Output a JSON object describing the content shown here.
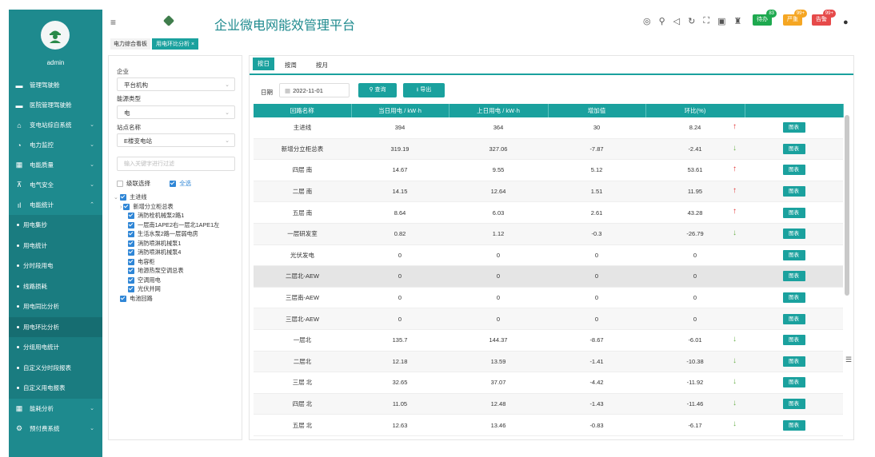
{
  "app": {
    "title": "企业微电网能效管理平台",
    "user": "admin"
  },
  "colors": {
    "sidebar": "#1e8a8e",
    "accent": "#1aa19e",
    "up": "#e03030",
    "down": "#6ab04c"
  },
  "sidebar": {
    "items": [
      {
        "label": "管理驾驶舱",
        "icon": "monitor-icon"
      },
      {
        "label": "医院管理驾驶舱",
        "icon": "monitor-icon"
      },
      {
        "label": "变电站综自系统",
        "icon": "home-icon"
      },
      {
        "label": "电力监控",
        "icon": "gauge-icon"
      },
      {
        "label": "电能质量",
        "icon": "chart-icon"
      },
      {
        "label": "电气安全",
        "icon": "tower-icon"
      },
      {
        "label": "电能统计",
        "icon": "bars-icon"
      }
    ],
    "sub_items": [
      "用电集抄",
      "用电统计",
      "分时段用电",
      "线路损耗",
      "用电同比分析",
      "用电环比分析",
      "分组用电统计",
      "自定义分时段报表",
      "自定义用电报表"
    ],
    "bottom_items": [
      {
        "label": "能耗分析",
        "icon": "chart-icon"
      },
      {
        "label": "预付费系统",
        "icon": "gear-icon"
      }
    ]
  },
  "tabs": {
    "home": "电力综合看板",
    "current": "用电环比分析 ×"
  },
  "badges": {
    "b1": "待办",
    "b1n": "83",
    "b2": "严重",
    "b2n": "99+",
    "b3": "告警",
    "b3n": "99+"
  },
  "filters": {
    "company_label": "企业",
    "company_value": "平台机构",
    "energy_label": "能源类型",
    "energy_value": "电",
    "station_label": "站点名称",
    "station_value": "E楼变电站",
    "search_placeholder": "输入关键字进行过滤",
    "cascade_label": "级联选择",
    "all_label": "全选"
  },
  "tree": {
    "root": "主进线",
    "child": "新增分立柜总表",
    "leaves": [
      "消防栓机械泵2路1",
      "一层南1APE2右一层北1APE1左",
      "生活水泵2路一层弱电房",
      "消防喷淋机械泵1",
      "消防喷淋机械泵4",
      "电容柜",
      "地源热泵空调总表",
      "空调用电",
      "光伏并网"
    ],
    "last": "电池回路"
  },
  "panel": {
    "tabs": [
      "按日",
      "按周",
      "按月"
    ],
    "date_label": "日期",
    "date_value": "2022-11-01",
    "query_label": "查询",
    "export_label": "导出",
    "columns": [
      "回路名称",
      "当日用电 / kW·h",
      "上日用电 / kW·h",
      "增加值",
      "环比(%)",
      ""
    ],
    "chart_button": "图表",
    "rows": [
      {
        "name": "主进线",
        "today": "394",
        "yesterday": "364",
        "diff": "30",
        "ratio": "8.24",
        "trend": "up"
      },
      {
        "name": "新增分立柜总表",
        "today": "319.19",
        "yesterday": "327.06",
        "diff": "-7.87",
        "ratio": "-2.41",
        "trend": "down"
      },
      {
        "name": "四层 南",
        "today": "14.67",
        "yesterday": "9.55",
        "diff": "5.12",
        "ratio": "53.61",
        "trend": "up"
      },
      {
        "name": "二层 南",
        "today": "14.15",
        "yesterday": "12.64",
        "diff": "1.51",
        "ratio": "11.95",
        "trend": "up"
      },
      {
        "name": "五层 南",
        "today": "8.64",
        "yesterday": "6.03",
        "diff": "2.61",
        "ratio": "43.28",
        "trend": "up"
      },
      {
        "name": "一层研发室",
        "today": "0.82",
        "yesterday": "1.12",
        "diff": "-0.3",
        "ratio": "-26.79",
        "trend": "down"
      },
      {
        "name": "光伏发电",
        "today": "0",
        "yesterday": "0",
        "diff": "0",
        "ratio": "0",
        "trend": ""
      },
      {
        "name": "二层北-AEW",
        "today": "0",
        "yesterday": "0",
        "diff": "0",
        "ratio": "0",
        "trend": ""
      },
      {
        "name": "三层南-AEW",
        "today": "0",
        "yesterday": "0",
        "diff": "0",
        "ratio": "0",
        "trend": ""
      },
      {
        "name": "三层北-AEW",
        "today": "0",
        "yesterday": "0",
        "diff": "0",
        "ratio": "0",
        "trend": ""
      },
      {
        "name": "一层北",
        "today": "135.7",
        "yesterday": "144.37",
        "diff": "-8.67",
        "ratio": "-6.01",
        "trend": "down"
      },
      {
        "name": "二层北",
        "today": "12.18",
        "yesterday": "13.59",
        "diff": "-1.41",
        "ratio": "-10.38",
        "trend": "down"
      },
      {
        "name": "三层 北",
        "today": "32.65",
        "yesterday": "37.07",
        "diff": "-4.42",
        "ratio": "-11.92",
        "trend": "down"
      },
      {
        "name": "四层 北",
        "today": "11.05",
        "yesterday": "12.48",
        "diff": "-1.43",
        "ratio": "-11.46",
        "trend": "down"
      },
      {
        "name": "五层 北",
        "today": "12.63",
        "yesterday": "13.46",
        "diff": "-0.83",
        "ratio": "-6.17",
        "trend": "down"
      }
    ]
  }
}
